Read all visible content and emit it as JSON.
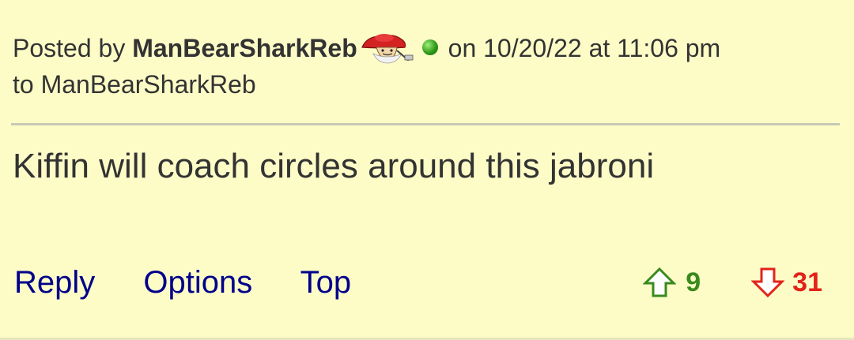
{
  "post": {
    "posted_by_label": "Posted by",
    "author": "ManBearSharkReb",
    "date_prefix": "on",
    "date": "10/20/22 at 11:06 pm",
    "reply_to_label": "to",
    "reply_to": "ManBearSharkReb",
    "body": "Kiffin will coach circles around this jabroni",
    "online_status_color": "#2f9a18"
  },
  "actions": {
    "reply": "Reply",
    "options": "Options",
    "top": "Top"
  },
  "votes": {
    "up": "9",
    "down": "31",
    "up_color": "#3a8a1e",
    "down_color": "#e2231a",
    "up_icon": "arrow-up-outline-icon",
    "down_icon": "arrow-down-outline-icon"
  },
  "colors": {
    "background": "#fdfcc7",
    "link": "#00008b",
    "text": "#333333"
  }
}
